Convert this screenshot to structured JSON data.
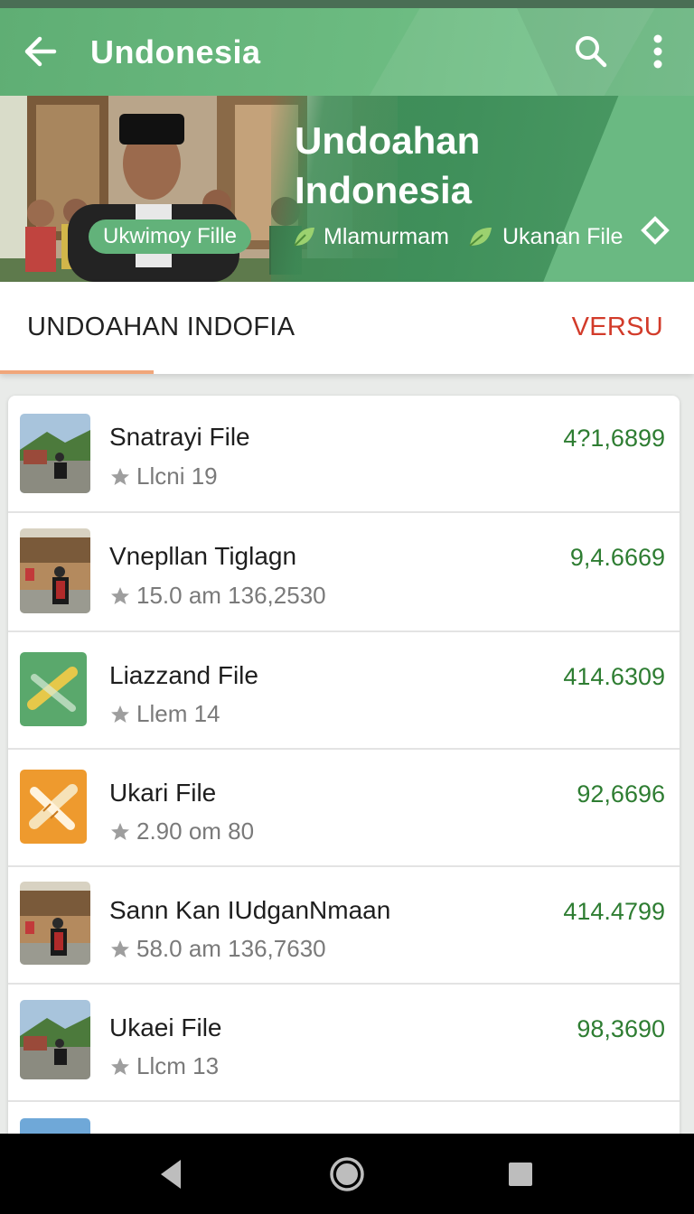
{
  "appbar": {
    "title": "Undonesia",
    "back_icon": "arrow-left-icon",
    "search_icon": "search-icon",
    "menu_icon": "more-vert-icon"
  },
  "hero": {
    "title": "Undoahan Indonesia",
    "chip_label": "Ukwimoy Fille",
    "meta1": "Mlamurmam",
    "meta2": "Ukanan File",
    "action_icon": "diamond-icon"
  },
  "tabs": {
    "left": "UNDOAHAN INDOFIA",
    "right": "VERSU"
  },
  "list": {
    "items": [
      {
        "title": "Snatrayi File",
        "subtitle": "Llcni 19",
        "value": "4?1,6899",
        "thumb": "photo"
      },
      {
        "title": "Vnepllan Tiglagn",
        "subtitle": "15.0 am 136,2530",
        "value": "9,4.6669",
        "thumb": "photo"
      },
      {
        "title": "Liazzand File",
        "subtitle": "Llem 14",
        "value": "414.6309",
        "thumb": "pencil-green"
      },
      {
        "title": "Ukari File",
        "subtitle": "2.90 om 80",
        "value": "92,6696",
        "thumb": "pencil-orange"
      },
      {
        "title": "Sann Kan IUdganNmaan",
        "subtitle": "58.0 am 136,7630",
        "value": "414.4799",
        "thumb": "photo"
      },
      {
        "title": "Ukaei File",
        "subtitle": "Llcm 13",
        "value": "98,3690",
        "thumb": "photo"
      }
    ]
  },
  "colors": {
    "accent_green": "#5fae74",
    "tab_red": "#d23b2a",
    "value_green": "#2e7d32"
  },
  "nav": {
    "back_icon": "nav-back-icon",
    "home_icon": "nav-home-icon",
    "recents_icon": "nav-recents-icon"
  }
}
